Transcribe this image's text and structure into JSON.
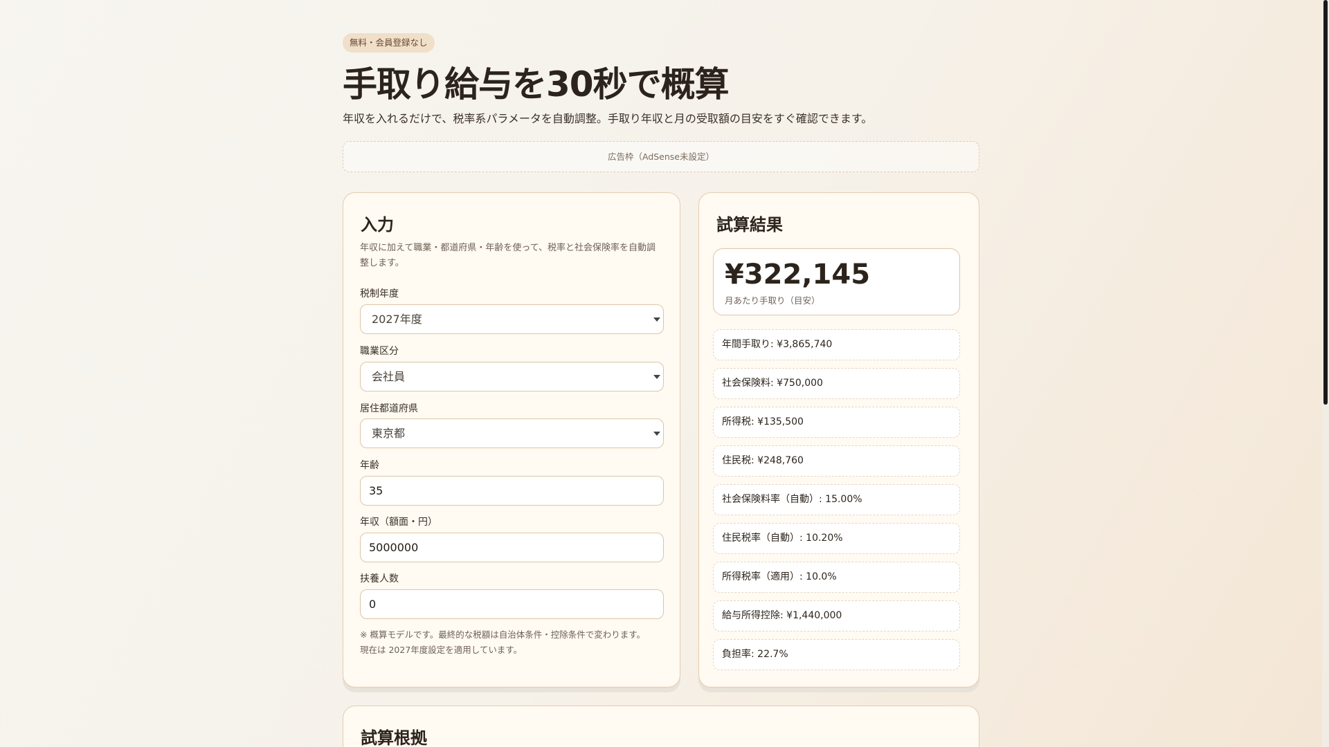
{
  "header": {
    "badge": "無料・会員登録なし",
    "title": "手取り給与を30秒で概算",
    "subtitle": "年収を入れるだけで、税率系パラメータを自動調整。手取り年収と月の受取額の目安をすぐ確認できます。",
    "ad": "広告枠（AdSense未設定）"
  },
  "input": {
    "title": "入力",
    "description": "年収に加えて職業・都道府県・年齢を使って、税率と社会保険率を自動調整します。",
    "tax_year_label": "税制年度",
    "tax_year": "2027年度",
    "job_label": "職業区分",
    "job": "会社員",
    "pref_label": "居住都道府県",
    "pref": "東京都",
    "age_label": "年齢",
    "age": "35",
    "income_label": "年収（額面・円）",
    "income": "5000000",
    "dependents_label": "扶養人数",
    "dependents": "0",
    "note1": "※ 概算モデルです。最終的な税額は自治体条件・控除条件で変わります。",
    "note2": "現在は 2027年度設定を適用しています。"
  },
  "result": {
    "title": "試算結果",
    "monthly": "¥322,145",
    "monthly_caption": "月あたり手取り（目安）",
    "rows": [
      "年間手取り: ¥3,865,740",
      "社会保険料: ¥750,000",
      "所得税: ¥135,500",
      "住民税: ¥248,760",
      "社会保険料率（自動）: 15.00%",
      "住民税率（自動）: 10.20%",
      "所得税率（適用）: 10.0%",
      "給与所得控除: ¥1,440,000",
      "負担率: 22.7%"
    ]
  },
  "basis": {
    "title": "試算根拠"
  }
}
